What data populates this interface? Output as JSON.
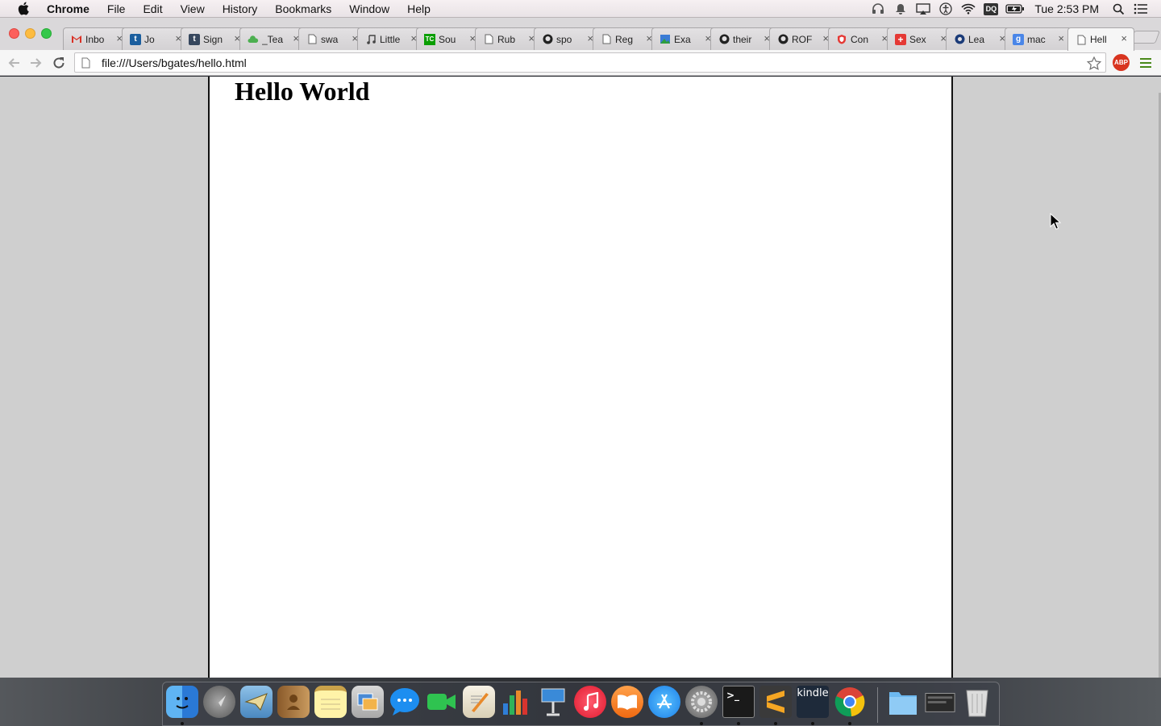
{
  "menubar": {
    "app_name": "Chrome",
    "menus": [
      "File",
      "Edit",
      "View",
      "History",
      "Bookmarks",
      "Window",
      "Help"
    ],
    "clock": "Tue 2:53 PM",
    "status_icons": [
      "headphones-icon",
      "notification-bell-icon",
      "airplay-icon",
      "accessibility-icon",
      "wifi-icon",
      "dq-icon",
      "battery-icon",
      "spotlight-search-icon",
      "notification-center-icon"
    ],
    "dq_label": "DQ"
  },
  "tabs": [
    {
      "title": "Inbo",
      "favicon": "gmail-icon"
    },
    {
      "title": "Jo",
      "favicon": "trello-icon"
    },
    {
      "title": "Sign",
      "favicon": "tumblr-icon"
    },
    {
      "title": "_Tea",
      "favicon": "cloud-icon"
    },
    {
      "title": "swa",
      "favicon": "document-icon"
    },
    {
      "title": "Little",
      "favicon": "music-icon"
    },
    {
      "title": "Sou",
      "favicon": "tc-icon"
    },
    {
      "title": "Rub",
      "favicon": "document-icon"
    },
    {
      "title": "spo",
      "favicon": "github-icon"
    },
    {
      "title": "Reg",
      "favicon": "document-icon"
    },
    {
      "title": "Exa",
      "favicon": "picture-icon"
    },
    {
      "title": "their",
      "favicon": "github-icon"
    },
    {
      "title": "ROF",
      "favicon": "github-icon"
    },
    {
      "title": "Con",
      "favicon": "shield-icon"
    },
    {
      "title": "Sex",
      "favicon": "plus-icon"
    },
    {
      "title": "Lea",
      "favicon": "blue-logo-icon"
    },
    {
      "title": "mac",
      "favicon": "google-icon"
    },
    {
      "title": "Hell",
      "favicon": "document-icon",
      "active": true
    }
  ],
  "toolbar": {
    "url": "file:///Users/bgates/hello.html",
    "abp_label": "ABP"
  },
  "page": {
    "heading": "Hello World"
  },
  "dock": {
    "apps": [
      "Finder",
      "Launchpad",
      "Mail",
      "Contacts",
      "Notes",
      "Preview",
      "Messages",
      "FaceTime",
      "Pages",
      "Numbers",
      "Keynote",
      "iTunes",
      "iBooks",
      "App Store",
      "System Preferences",
      "Terminal",
      "Sublime Text",
      "Kindle",
      "Chrome",
      "Downloads",
      "Screenshots",
      "Trash"
    ],
    "kindle_label": "kindle",
    "terminal_label": ">_"
  },
  "colors": {
    "page_background": "#ffffff",
    "viewport_background": "#cfcfcf",
    "abp_red": "#d8341f"
  }
}
